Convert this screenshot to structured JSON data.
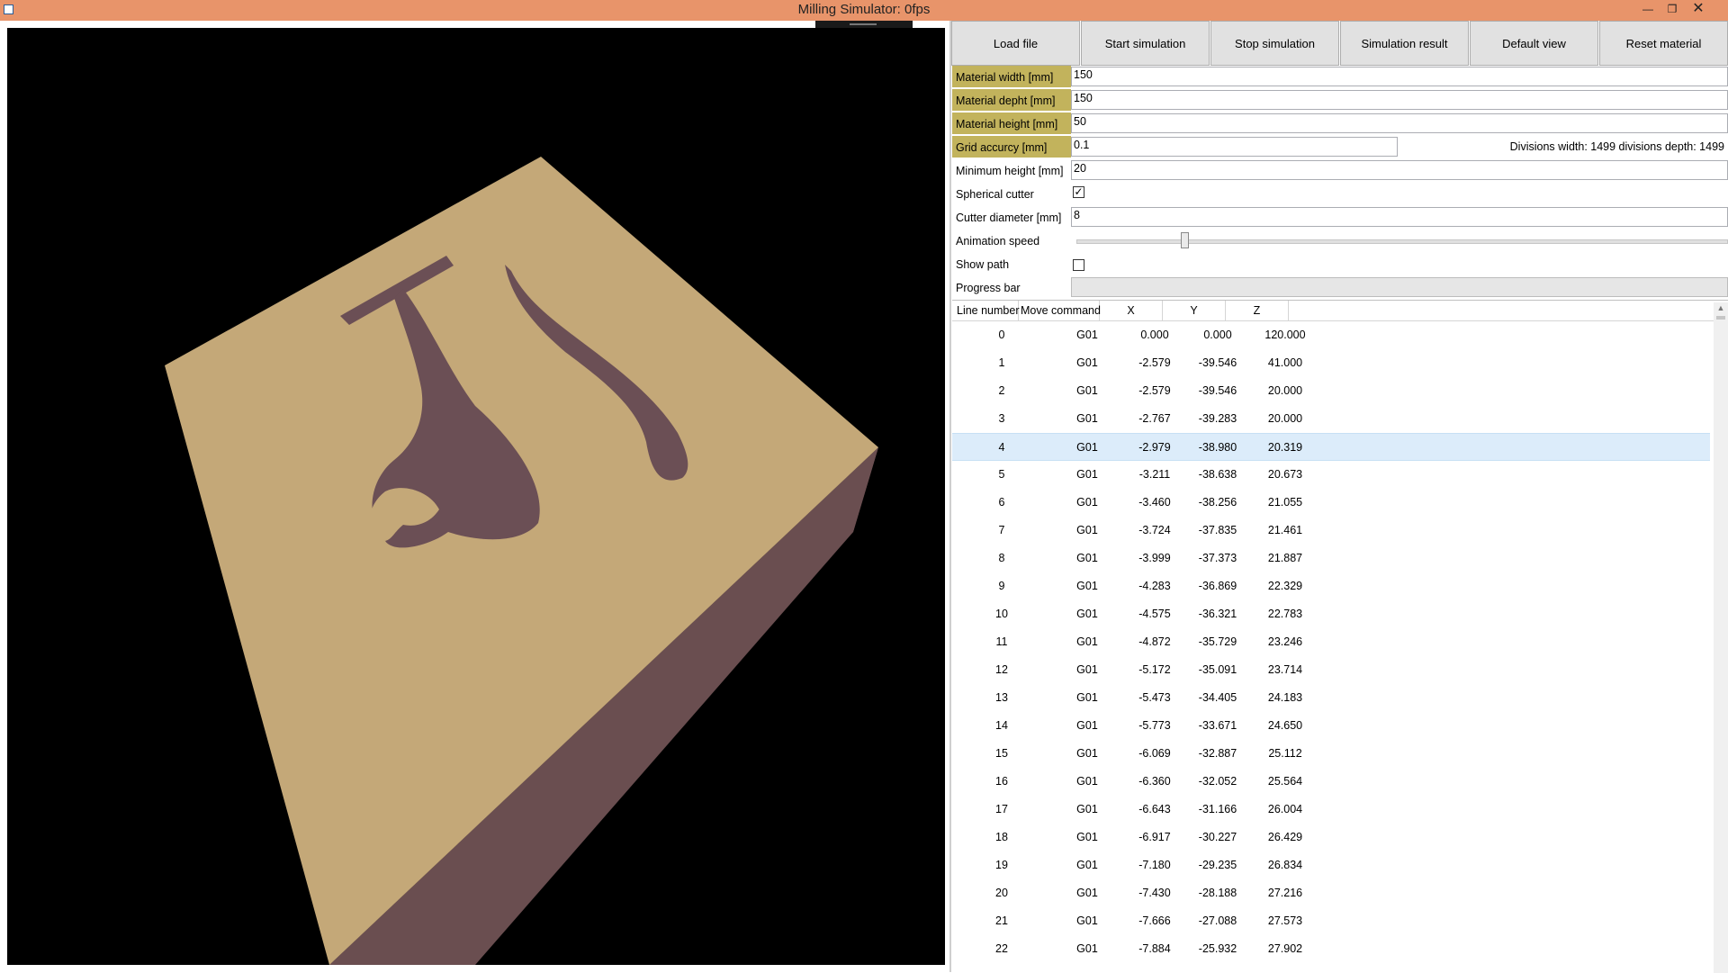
{
  "window": {
    "title": "Milling Simulator: 0fps"
  },
  "colors": {
    "titlebar": "#e8946a",
    "material_top": "#c4a878",
    "material_side": "#6a4e50",
    "field_highlight": "#c2b35c",
    "selection": "#dcecfa"
  },
  "toolbar": {
    "load_file": "Load file",
    "start_simulation": "Start simulation",
    "stop_simulation": "Stop simulation",
    "simulation_result": "Simulation result",
    "default_view": "Default view",
    "reset_material": "Reset material"
  },
  "settings": {
    "material_width_label": "Material width [mm]",
    "material_width": "150",
    "material_depth_label": "Material depht [mm]",
    "material_depth": "150",
    "material_height_label": "Material height [mm]",
    "material_height": "50",
    "grid_accuracy_label": "Grid accurcy [mm]",
    "grid_accuracy": "0.1",
    "divisions_info": "Divisions width: 1499 divisions depth: 1499",
    "minimum_height_label": "Minimum height [mm]",
    "minimum_height": "20",
    "spherical_cutter_label": "Spherical cutter",
    "spherical_cutter_checked": true,
    "cutter_diameter_label": "Cutter diameter [mm]",
    "cutter_diameter": "8",
    "animation_speed_label": "Animation speed",
    "animation_speed": 0.16,
    "show_path_label": "Show path",
    "show_path_checked": false,
    "progress_bar_label": "Progress bar",
    "progress": 0
  },
  "grid": {
    "columns": [
      "Line number",
      "Move command",
      "X",
      "Y",
      "Z"
    ],
    "selected_row": 4,
    "rows": [
      [
        "0",
        "G01",
        "0.000",
        "0.000",
        "120.000"
      ],
      [
        "1",
        "G01",
        "-2.579",
        "-39.546",
        "41.000"
      ],
      [
        "2",
        "G01",
        "-2.579",
        "-39.546",
        "20.000"
      ],
      [
        "3",
        "G01",
        "-2.767",
        "-39.283",
        "20.000"
      ],
      [
        "4",
        "G01",
        "-2.979",
        "-38.980",
        "20.319"
      ],
      [
        "5",
        "G01",
        "-3.211",
        "-38.638",
        "20.673"
      ],
      [
        "6",
        "G01",
        "-3.460",
        "-38.256",
        "21.055"
      ],
      [
        "7",
        "G01",
        "-3.724",
        "-37.835",
        "21.461"
      ],
      [
        "8",
        "G01",
        "-3.999",
        "-37.373",
        "21.887"
      ],
      [
        "9",
        "G01",
        "-4.283",
        "-36.869",
        "22.329"
      ],
      [
        "10",
        "G01",
        "-4.575",
        "-36.321",
        "22.783"
      ],
      [
        "11",
        "G01",
        "-4.872",
        "-35.729",
        "23.246"
      ],
      [
        "12",
        "G01",
        "-5.172",
        "-35.091",
        "23.714"
      ],
      [
        "13",
        "G01",
        "-5.473",
        "-34.405",
        "24.183"
      ],
      [
        "14",
        "G01",
        "-5.773",
        "-33.671",
        "24.650"
      ],
      [
        "15",
        "G01",
        "-6.069",
        "-32.887",
        "25.112"
      ],
      [
        "16",
        "G01",
        "-6.360",
        "-32.052",
        "25.564"
      ],
      [
        "17",
        "G01",
        "-6.643",
        "-31.166",
        "26.004"
      ],
      [
        "18",
        "G01",
        "-6.917",
        "-30.227",
        "26.429"
      ],
      [
        "19",
        "G01",
        "-7.180",
        "-29.235",
        "26.834"
      ],
      [
        "20",
        "G01",
        "-7.430",
        "-28.188",
        "27.216"
      ],
      [
        "21",
        "G01",
        "-7.666",
        "-27.088",
        "27.573"
      ],
      [
        "22",
        "G01",
        "-7.884",
        "-25.932",
        "27.902"
      ]
    ]
  }
}
